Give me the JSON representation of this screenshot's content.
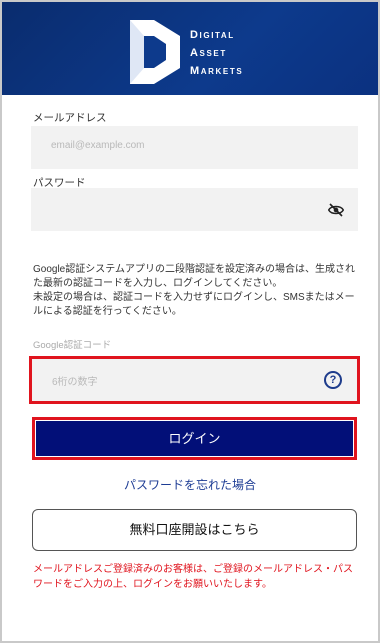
{
  "brand": {
    "line1": "Digital",
    "line2": "Asset",
    "line3": "Markets",
    "primary_color": "#0d3a8c"
  },
  "form": {
    "email_label": "メールアドレス",
    "email_placeholder": "email@example.com",
    "password_label": "パスワード",
    "password_toggle_icon": "eye-slash-icon",
    "info_line1": "Google認証システムアプリの二段階認証を設定済みの場合は、生成された最新の認証コードを入力し、ログインしてください。",
    "info_line2": "未設定の場合は、認証コードを入力せずにログインし、SMSまたはメールによる認証を行ってください。",
    "google_code_label": "Google認証コード",
    "google_code_placeholder": "6桁の数字",
    "help_icon": "?",
    "login_button": "ログイン",
    "forgot_link": "パスワードを忘れた場合",
    "open_account_button": "無料口座開設はこちら",
    "notice": "メールアドレスご登録済みのお客様は、ご登録のメールアドレス・パスワードをご入力の上、ログインをお願いいたします。"
  },
  "colors": {
    "highlight": "#e0141e",
    "button": "#020f78",
    "link": "#1d3c94"
  }
}
